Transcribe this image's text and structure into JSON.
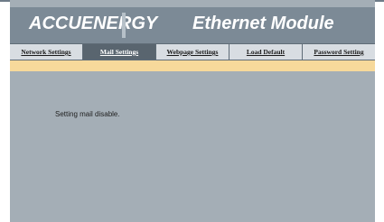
{
  "header": {
    "logo_text": "ACCUENERGY",
    "title": "Ethernet Module"
  },
  "nav": {
    "tabs": [
      {
        "label": "Network Settings",
        "active": false
      },
      {
        "label": "Mail Settings",
        "active": true
      },
      {
        "label": "Webpage Settings",
        "active": false
      },
      {
        "label": "Load Default",
        "active": false
      },
      {
        "label": "Password Setting",
        "active": false
      }
    ]
  },
  "main": {
    "message": "Setting mail disable."
  },
  "colors": {
    "header_bg": "#7c8a96",
    "content_bg": "#a4aeb6",
    "active_tab_bg": "#59656f",
    "notice_bar": "#f7d99b"
  }
}
